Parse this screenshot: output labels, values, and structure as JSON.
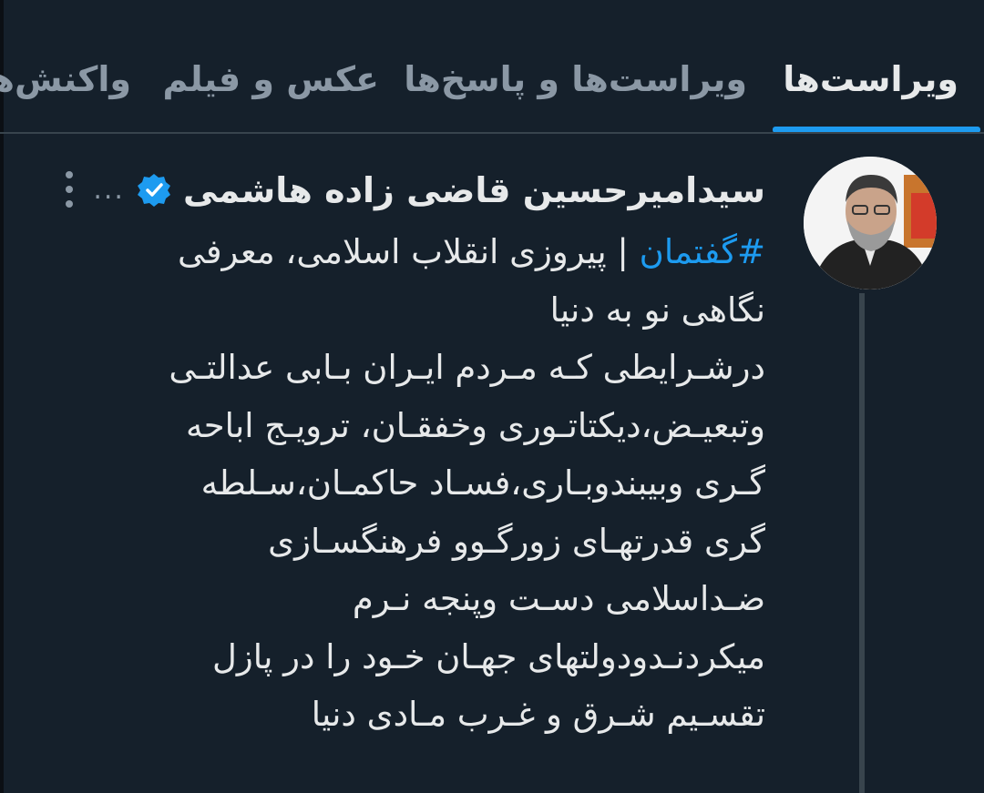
{
  "tabs": [
    {
      "label": "ویراست‌ها",
      "active": true
    },
    {
      "label": "ویراست‌ها و پاسخ‌ها",
      "active": false
    },
    {
      "label": "عکس و فیلم",
      "active": false
    },
    {
      "label": "واکنش‌ها",
      "active": false
    }
  ],
  "post": {
    "author_name": "سیدامیرحسین قاضی زاده هاشمی",
    "more_label": "...",
    "hashtag": "#گفتمان",
    "line1_rest": " | پیروزی انقلاب اسلامی، معرفی",
    "lines": [
      "نگاهی نو به دنیا",
      "درشـرایطی کـه مـردم ایـران بـابی عدالتـی",
      "وتبعیـض،دیکتاتـوری وخفقـان، ترویـج اباحه",
      "گـری وبیبندوبـاری،فسـاد حاکمـان،سـلطه",
      "گری قدرتهـای زورگـوو فرهنگسـازی",
      "ضـداسلامی دسـت وپنجه نـرم",
      "میکردنـدودولتهای جهـان خـود را در پازل",
      "تقسـیم شـرق و غـرب مـادی دنیا"
    ]
  },
  "colors": {
    "background": "#15202b",
    "accent": "#1d9bf0",
    "text": "#e7e9ea",
    "muted": "#8b98a5"
  }
}
